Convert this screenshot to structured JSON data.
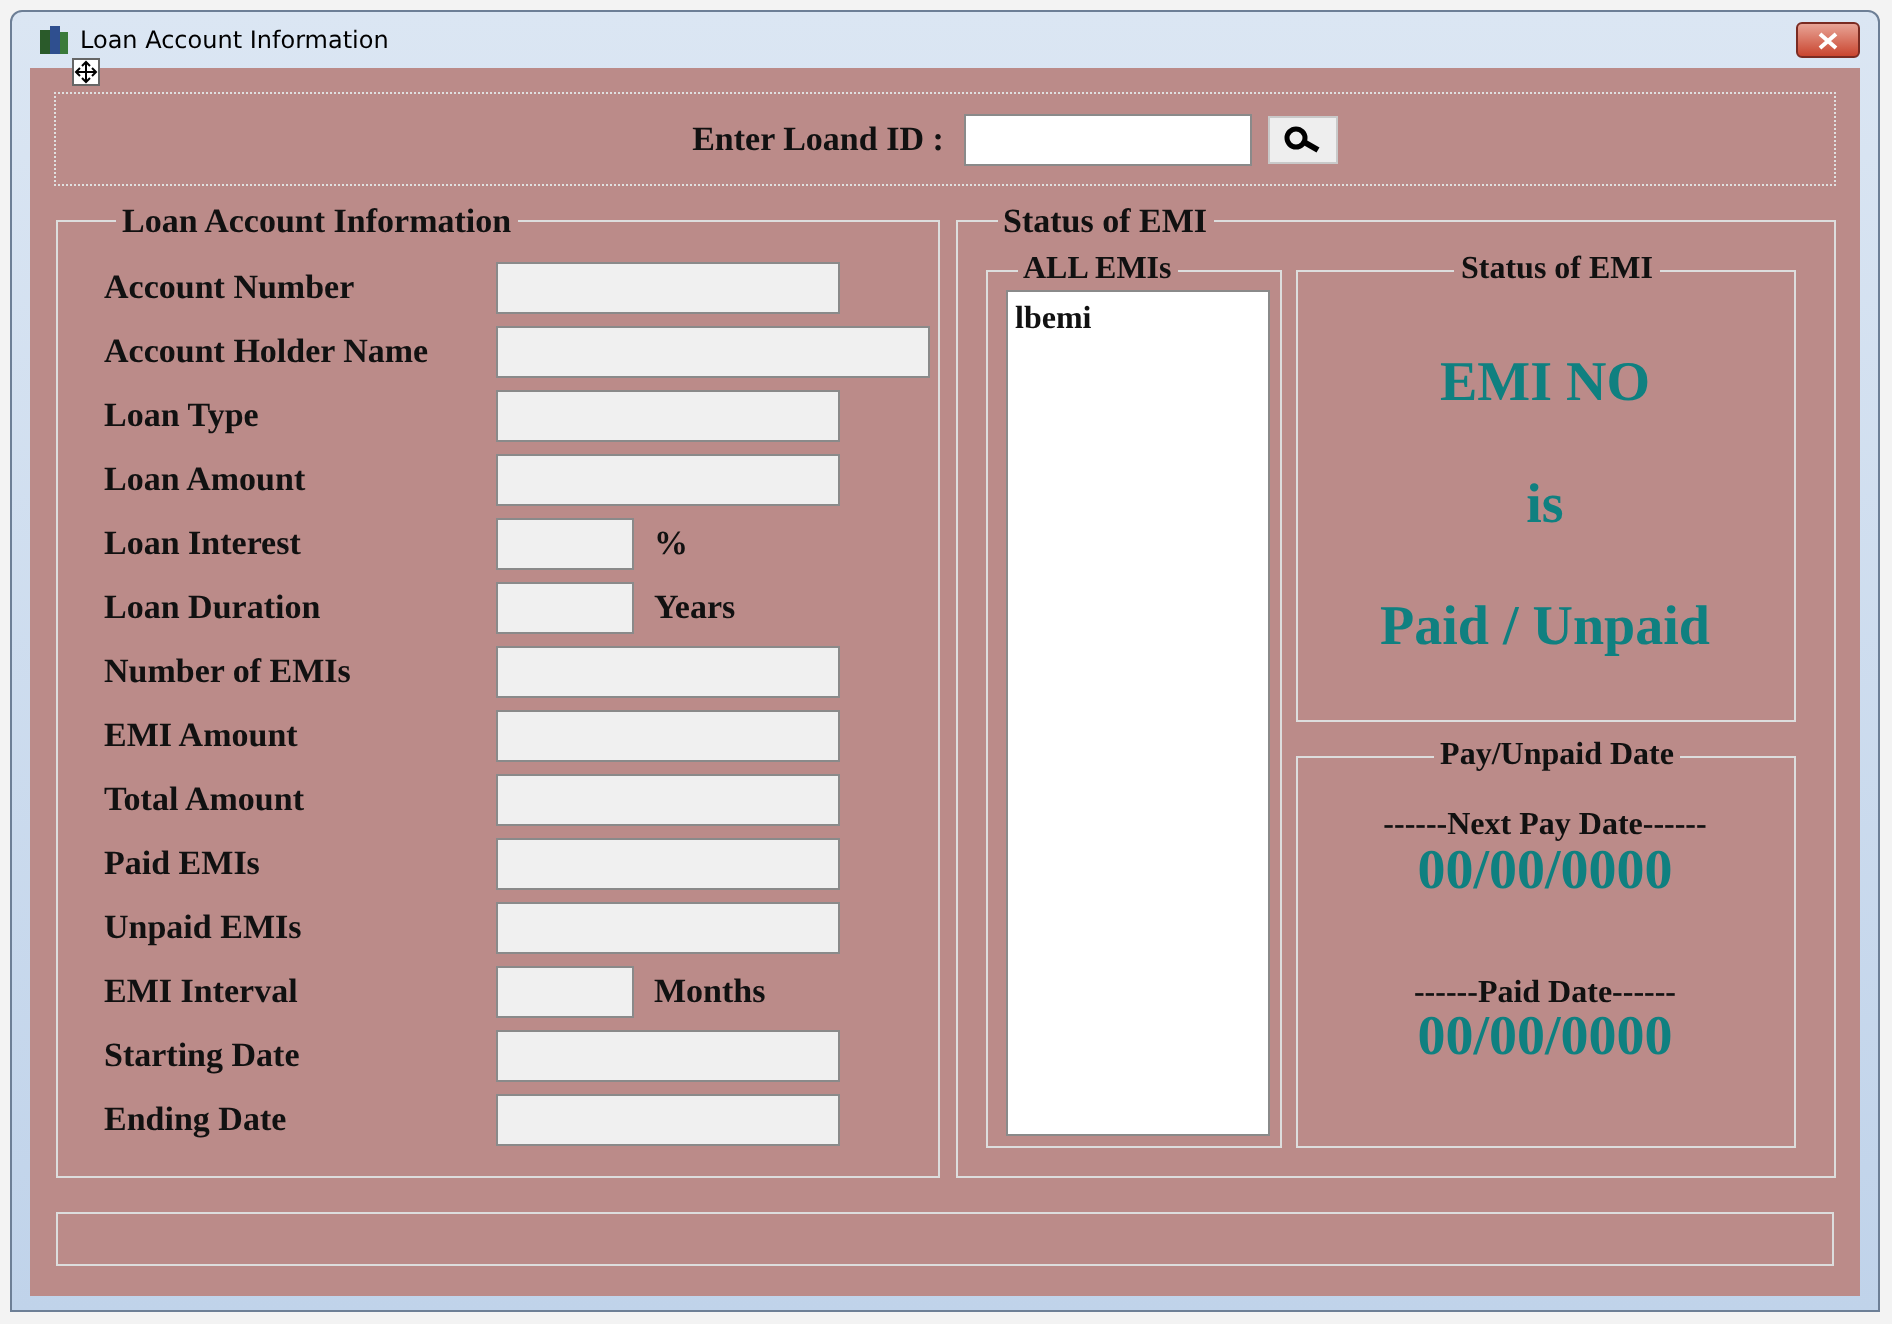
{
  "window": {
    "title": "Loan Account Information"
  },
  "search": {
    "label": "Enter Loand ID :"
  },
  "account_group": {
    "title": "Loan Account Information",
    "fields": [
      {
        "label": "Account Number",
        "kind": "normal"
      },
      {
        "label": "Account Holder Name",
        "kind": "wide"
      },
      {
        "label": "Loan Type",
        "kind": "normal"
      },
      {
        "label": "Loan Amount",
        "kind": "normal"
      },
      {
        "label": "Loan Interest",
        "kind": "short",
        "unit": "%"
      },
      {
        "label": "Loan Duration",
        "kind": "short",
        "unit": "Years"
      },
      {
        "label": "Number of EMIs",
        "kind": "normal"
      },
      {
        "label": "EMI Amount",
        "kind": "normal"
      },
      {
        "label": "Total Amount",
        "kind": "normal"
      },
      {
        "label": "Paid EMIs",
        "kind": "normal"
      },
      {
        "label": "Unpaid EMIs",
        "kind": "normal"
      },
      {
        "label": "EMI Interval",
        "kind": "short",
        "unit": "Months"
      },
      {
        "label": "Starting Date",
        "kind": "normal"
      },
      {
        "label": "Ending Date",
        "kind": "normal"
      }
    ]
  },
  "emi_group": {
    "title": "Status of EMI",
    "list": {
      "title": "ALL EMIs",
      "items": [
        "lbemi"
      ]
    },
    "status": {
      "title": "Status of EMI",
      "lines": [
        "EMI NO",
        "is",
        "Paid / Unpaid"
      ]
    },
    "dates": {
      "title": "Pay/Unpaid Date",
      "entries": [
        {
          "label": "------Next Pay Date------",
          "value": "00/00/0000"
        },
        {
          "label": "------Paid Date------",
          "value": "00/00/0000"
        }
      ]
    }
  }
}
